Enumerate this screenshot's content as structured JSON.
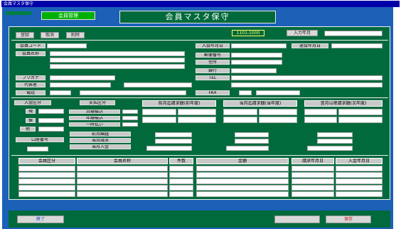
{
  "window": {
    "title": "会員マスタ保守"
  },
  "header": {
    "tab_label": "会員管理",
    "title": "会員マスタ保守"
  },
  "toolbar": {
    "btn1": "登録",
    "btn2": "取消",
    "btn3": "削除",
    "date_label": "1101-1000",
    "field_btn": "入力年月"
  },
  "form": {
    "member_code_label": "会員コード",
    "member_name_label": "会員名称",
    "kana_label": "フリガナ",
    "phone_label": "電話",
    "tel_label": "TEL",
    "reg_date_label": "入会年月日",
    "withdraw_label": "退会年月日",
    "rep_label": "代表者",
    "addr_label": "住所",
    "post_label": "郵便番号",
    "bank_label": "銀行",
    "fax_label": "FAX"
  },
  "left_box": {
    "title": "入金区分",
    "l1": "現",
    "l2": "振",
    "l3": "他",
    "l4": "口座番号"
  },
  "mid_box": {
    "title": "支払区分",
    "r1": "月額振込",
    "r2": "年額振込",
    "r3": "一時払い",
    "b1": "前月繰越",
    "b2": "当月請求",
    "b3": "当月入金"
  },
  "col_headers": {
    "c1": "前月迄請求額(前年度)",
    "c2": "当月迄請求額(当年度)",
    "c3": "翌月以降請求額(次年度)"
  },
  "table": {
    "headers": [
      "会員区分",
      "会員名称",
      "件数",
      "金額",
      "請求年月日",
      "入金年月日"
    ]
  },
  "footer": {
    "left_btn": "終了",
    "right_btn1": "",
    "right_btn2": "保存"
  }
}
